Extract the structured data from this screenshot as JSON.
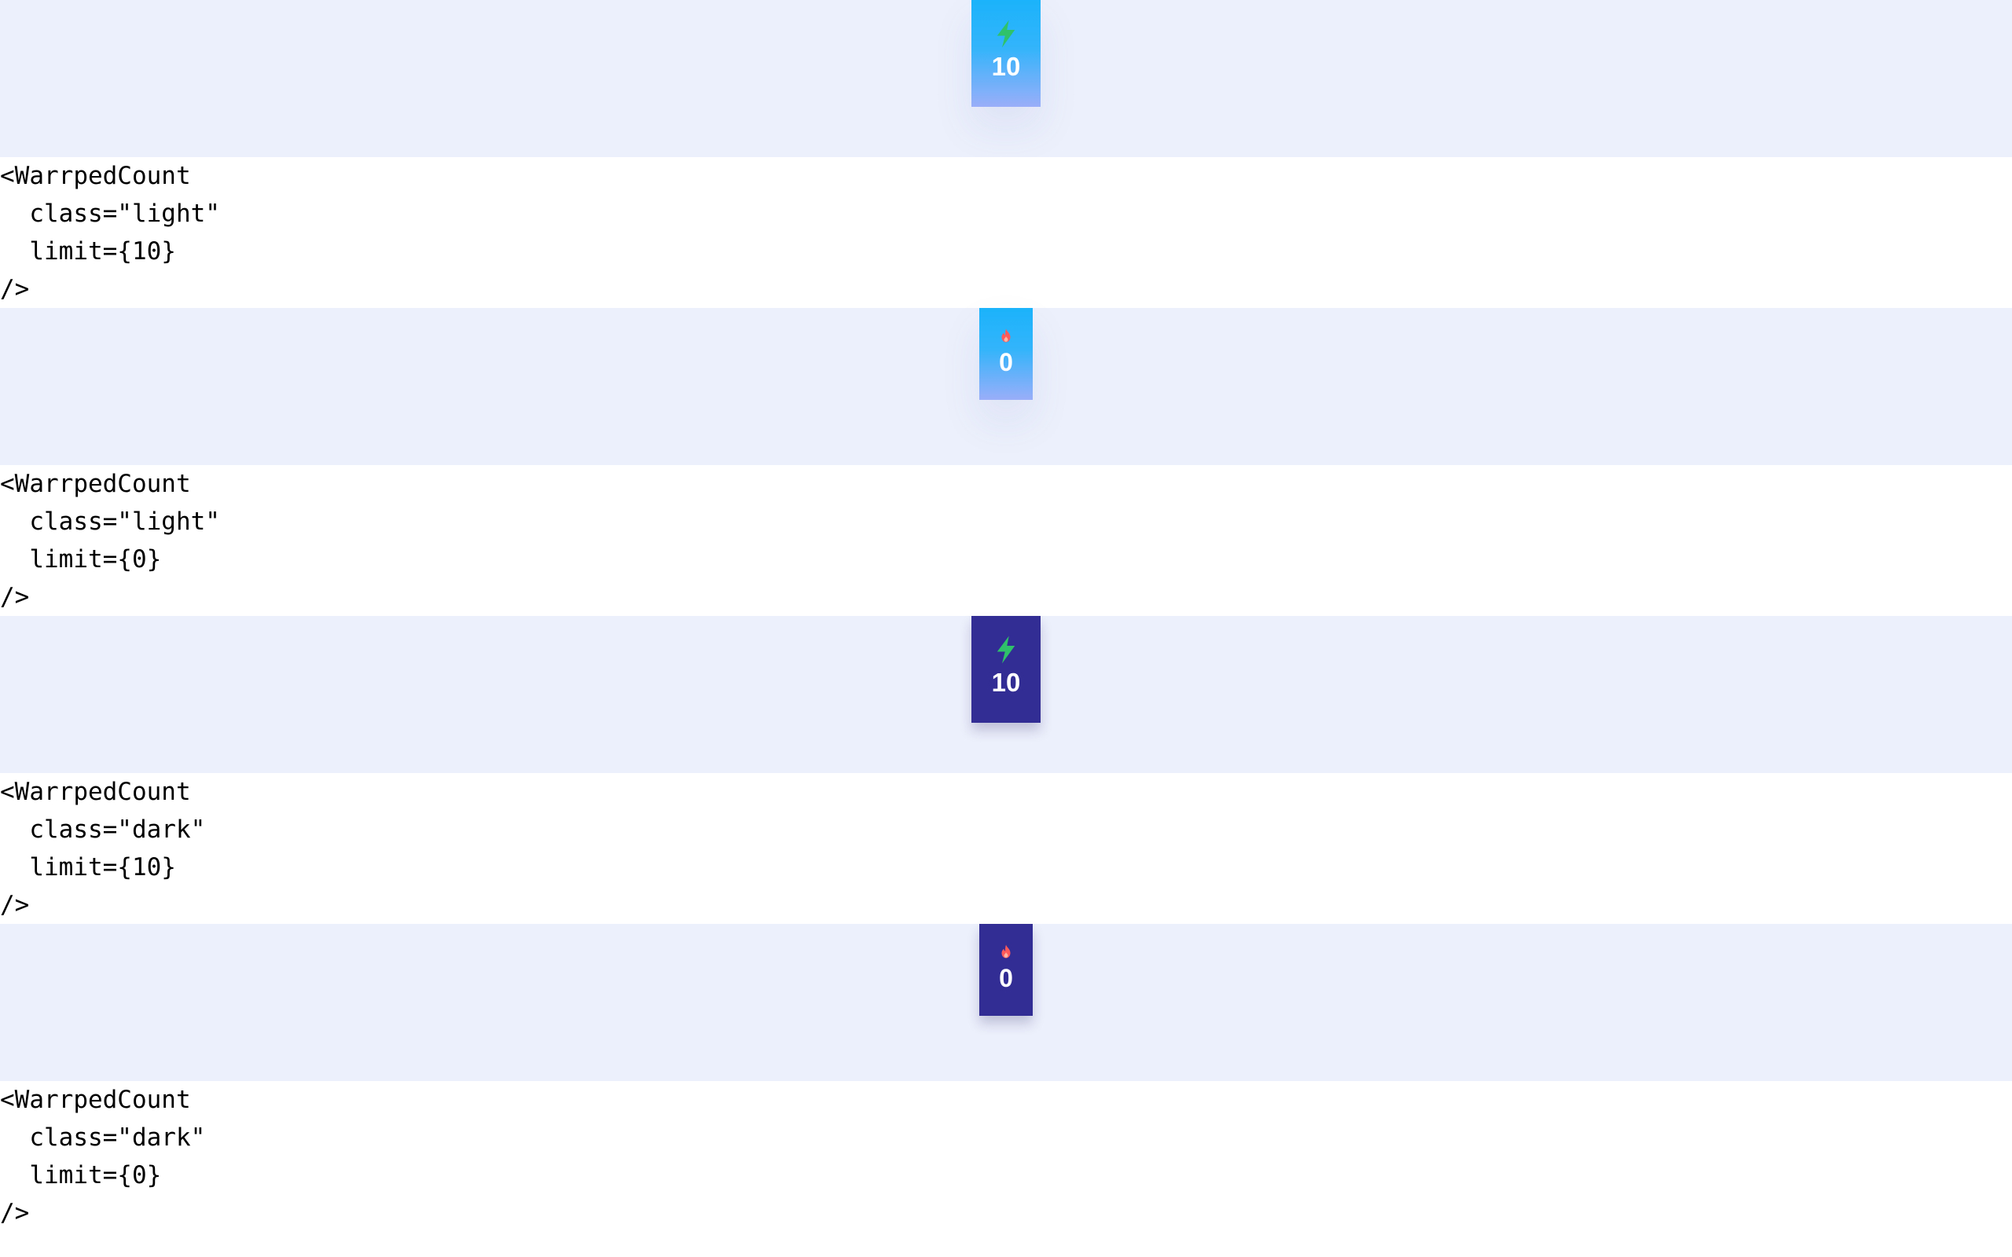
{
  "colors": {
    "preview_background": "#ecf0fc",
    "light_badge_gradient_top": "#1bb3fb",
    "light_badge_gradient_bottom": "#9aaef9",
    "dark_badge_background": "#322c95",
    "bolt_icon": "#2fc26a",
    "fire_icon": "#ff5a5a"
  },
  "examples": [
    {
      "variant": "light",
      "badge": {
        "icon": "lightning-bolt-icon",
        "count": "10"
      },
      "code_lines": [
        "<WarrpedCount",
        "  class=\"light\"",
        "  limit={10}",
        "/>"
      ]
    },
    {
      "variant": "light",
      "badge": {
        "icon": "fire-icon",
        "count": "0"
      },
      "code_lines": [
        "<WarrpedCount",
        "  class=\"light\"",
        "  limit={0}",
        "/>"
      ]
    },
    {
      "variant": "dark",
      "badge": {
        "icon": "lightning-bolt-icon",
        "count": "10"
      },
      "code_lines": [
        "<WarrpedCount",
        "  class=\"dark\"",
        "  limit={10}",
        "/>"
      ]
    },
    {
      "variant": "dark",
      "badge": {
        "icon": "fire-icon",
        "count": "0"
      },
      "code_lines": [
        "<WarrpedCount",
        "  class=\"dark\"",
        "  limit={0}",
        "/>"
      ]
    }
  ]
}
